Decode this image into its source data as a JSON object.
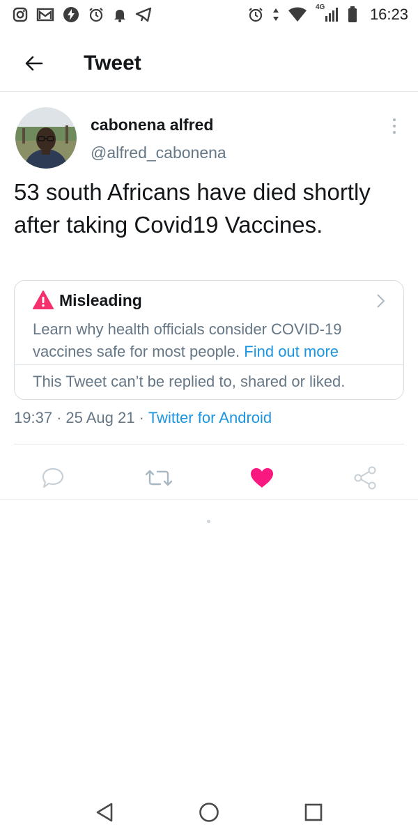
{
  "status_bar": {
    "time": "16:23",
    "network": "4G",
    "left_icons": [
      "instagram-icon",
      "gmail-icon",
      "bolt-icon",
      "alarm-icon",
      "notification-bell-icon",
      "telegram-icon"
    ],
    "right_icons": [
      "alarm-icon",
      "data-arrows-icon",
      "wifi-icon",
      "signal-icon",
      "battery-icon"
    ]
  },
  "header": {
    "title": "Tweet",
    "back_icon": "arrow-left-icon"
  },
  "tweet": {
    "author_name": "cabonena alfred",
    "author_handle": "@alfred_cabonena",
    "text": "53 south Africans have died shortly after taking Covid19 Vaccines.",
    "notice": {
      "label": "Misleading",
      "body": "Learn why health officials consider COVID-19 vaccines safe for most people.",
      "link": "Find out more",
      "footer": "This Tweet can’t be replied to, shared or liked."
    },
    "time": "19:37",
    "separator": "·",
    "date": "25 Aug 21",
    "source": "Twitter for Android",
    "actions": [
      "reply-icon",
      "retweet-icon",
      "like-icon",
      "share-icon"
    ]
  },
  "colors": {
    "link": "#1b95e0",
    "like": "#f91880",
    "misleading": "#f4316c",
    "muted": "#657786",
    "text": "#14171a",
    "border": "#e1e8ed"
  }
}
